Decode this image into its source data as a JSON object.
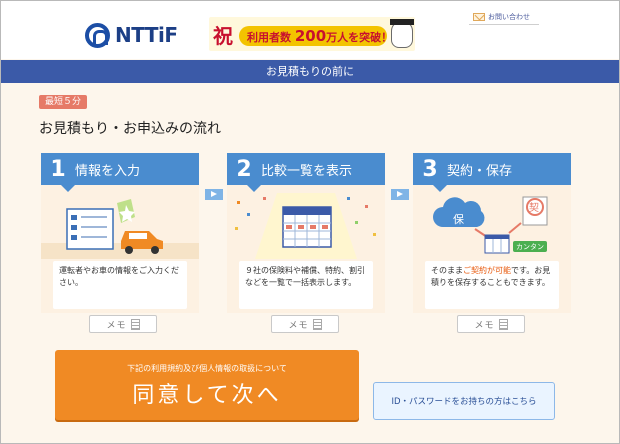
{
  "header": {
    "logo_text": "NTTiF",
    "banner": {
      "iwai": "祝",
      "prefix": "利用者数",
      "number": "200",
      "suffix": "万人を突破！"
    },
    "contact_label": "お問い合わせ"
  },
  "navbar": {
    "title": "お見積もりの前に"
  },
  "intro": {
    "time_badge": "最短５分",
    "title": "お見積もり・お申込みの流れ"
  },
  "steps": [
    {
      "num": "1",
      "label": "情報を入力",
      "desc": "運転者やお車の情報をご入力ください。",
      "memo": "メモ"
    },
    {
      "num": "2",
      "label": "比較一覧を表示",
      "desc": "９社の保険料や補償、特約、割引などを一覧で一括表示します。",
      "memo": "メモ"
    },
    {
      "num": "3",
      "label": "契約・保存",
      "desc_pre": "そのまま",
      "desc_accent": "ご契約が可能",
      "desc_post": "です。お見積りを保存することもできます。",
      "memo": "メモ",
      "illus_label_left": "保",
      "illus_label_right": "契",
      "illus_tag": "カンタン"
    }
  ],
  "agree_button": {
    "sub_label": "下記の利用規約及び個人情報の取扱について",
    "label": "同意して次へ"
  },
  "id_button": {
    "label": "ID・パスワードをお持ちの方はこちら"
  },
  "colors": {
    "brand_blue": "#3b5aa8",
    "step_blue": "#4a8ccf",
    "orange": "#f08a24",
    "badge_red": "#e67a67",
    "accent_orange": "#e8590c"
  }
}
